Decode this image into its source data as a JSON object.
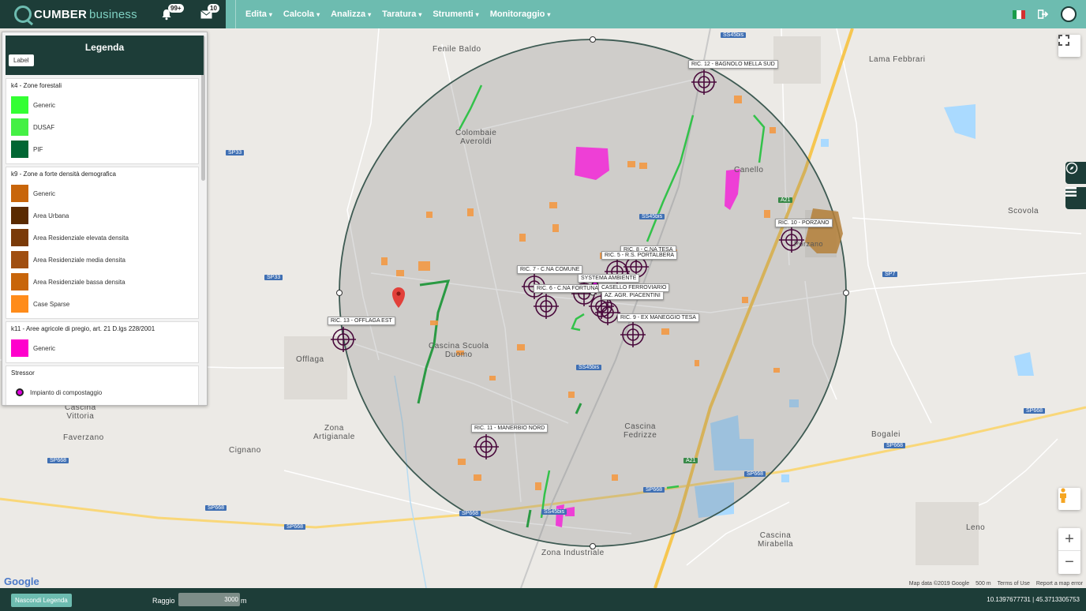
{
  "brand": {
    "name": "CUMBER",
    "suffix": "business"
  },
  "header": {
    "notifications_badge": "99+",
    "messages_badge": "10",
    "menu": [
      {
        "label": "Edita"
      },
      {
        "label": "Calcola"
      },
      {
        "label": "Analizza"
      },
      {
        "label": "Taratura"
      },
      {
        "label": "Strumenti"
      },
      {
        "label": "Monitoraggio"
      }
    ]
  },
  "legend": {
    "title": "Legenda",
    "label_button": "Label",
    "groups": [
      {
        "title": "k4 - Zone forestali",
        "items": [
          {
            "label": "Generic",
            "color": "#33ff33"
          },
          {
            "label": "DUSAF",
            "color": "#44f044"
          },
          {
            "label": "PIF",
            "color": "#006633"
          }
        ]
      },
      {
        "title": "k9 - Zone a forte densità demografica",
        "items": [
          {
            "label": "Generic",
            "color": "#c8650a"
          },
          {
            "label": "Area Urbana",
            "color": "#5a2a00"
          },
          {
            "label": "Area Residenziale elevata densita",
            "color": "#7a3a08"
          },
          {
            "label": "Area Residenziale media densita",
            "color": "#a04e10"
          },
          {
            "label": "Area Residenziale bassa densita",
            "color": "#c8650a"
          },
          {
            "label": "Case Sparse",
            "color": "#ff8c1a"
          }
        ]
      },
      {
        "title": "k11 - Aree agricole di pregio, art. 21 D.lgs 228/2001",
        "items": [
          {
            "label": "Generic",
            "color": "#ff00cc"
          }
        ]
      }
    ],
    "stressor": {
      "title": "Stressor",
      "item": "Impianto di compostaggio"
    }
  },
  "map": {
    "places": [
      {
        "name": "Fenile Baldo"
      },
      {
        "name": "Colombaie\nAveroldi"
      },
      {
        "name": "Lama Febbrari"
      },
      {
        "name": "Canello"
      },
      {
        "name": "Scovola"
      },
      {
        "name": "Cascina Scuola\nDuomo"
      },
      {
        "name": "Offlaga"
      },
      {
        "name": "Cascina\nVittoria"
      },
      {
        "name": "Faverzano"
      },
      {
        "name": "Zona\nArtigianale"
      },
      {
        "name": "Cignano"
      },
      {
        "name": "Cascina\nFedrizze"
      },
      {
        "name": "Bogalei"
      },
      {
        "name": "Leno"
      },
      {
        "name": "Cascina\nMirabella"
      },
      {
        "name": "Zona Industriale"
      },
      {
        "name": "Porzano"
      }
    ],
    "shields": [
      "SS45bis",
      "SP33",
      "SP33",
      "SS45bis",
      "SS45bis",
      "SS45bis",
      "SP7",
      "SP668",
      "SP668",
      "SP668",
      "SP668",
      "SP668",
      "SP668",
      "SP668",
      "SP668",
      "A21",
      "A21"
    ],
    "receptors": [
      "RIC. 12 - BAGNOLO MELLA SUD",
      "RIC. 10 - PORZANO",
      "RIC. 8 - C.NA TESA",
      "RIC. 5 - R.S. PORTALBERA",
      "RIC. 7 - C.NA COMUNE",
      "RIC. 6 - C.NA FORTUNATA",
      "SYSTEMA AMBIENTE",
      "CASELLO FERROVIARIO",
      "AZ. AGR. PIACENTINI",
      "RIC. 9 - EX MANEGGIO TESA",
      "RIC. 13 - OFFLAGA EST",
      "RIC. 11 - MANERBIO NORD"
    ],
    "attribution": "Map data ©2019 Google",
    "scale": "500 m",
    "terms": "Terms of Use",
    "report": "Report a map error",
    "google": "Google"
  },
  "footer": {
    "hide_legend": "Nascondi Legenda",
    "radius_label": "Raggio",
    "radius_value": "3000",
    "radius_unit": "m",
    "coords": "10.1397677731 | 45.3713305753"
  }
}
